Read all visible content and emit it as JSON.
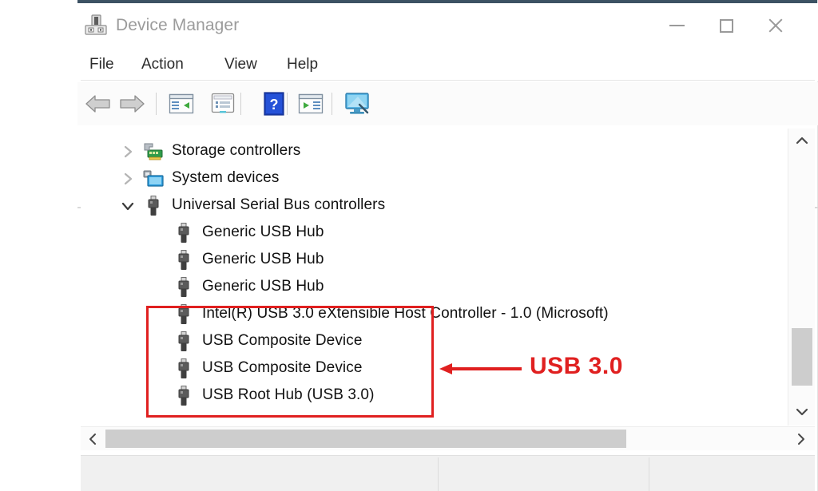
{
  "window": {
    "title": "Device Manager",
    "title_icon": "device-manager-icon",
    "controls": {
      "minimize": "minimize-icon",
      "maximize": "maximize-icon",
      "close": "close-icon"
    }
  },
  "menubar": {
    "items": [
      {
        "label": "File"
      },
      {
        "label": "Action"
      },
      {
        "label": "View"
      },
      {
        "label": "Help"
      }
    ]
  },
  "toolbar": {
    "buttons": [
      {
        "name": "back-arrow-icon"
      },
      {
        "name": "forward-arrow-icon"
      },
      {
        "name": "properties-icon"
      },
      {
        "name": "show-details-icon"
      },
      {
        "name": "help-icon"
      },
      {
        "name": "update-driver-icon"
      },
      {
        "name": "scan-for-hardware-changes-icon"
      }
    ]
  },
  "tree": {
    "rows": [
      {
        "label": "Storage controllers",
        "level": 0,
        "expander": "chevron-right-icon",
        "expanded": false,
        "icon": "storage-controller-icon"
      },
      {
        "label": "System devices",
        "level": 0,
        "expander": "chevron-right-icon",
        "expanded": false,
        "icon": "system-device-icon"
      },
      {
        "label": "Universal Serial Bus controllers",
        "level": 0,
        "expander": "chevron-down-icon",
        "expanded": true,
        "icon": "usb-icon"
      },
      {
        "label": "Generic USB Hub",
        "level": 1,
        "icon": "usb-icon"
      },
      {
        "label": "Generic USB Hub",
        "level": 1,
        "icon": "usb-icon"
      },
      {
        "label": "Generic USB Hub",
        "level": 1,
        "icon": "usb-icon"
      },
      {
        "label": "Intel(R) USB 3.0 eXtensible Host Controller - 1.0 (Microsoft)",
        "level": 1,
        "icon": "usb-icon"
      },
      {
        "label": "USB Composite Device",
        "level": 1,
        "icon": "usb-icon"
      },
      {
        "label": "USB Composite Device",
        "level": 1,
        "icon": "usb-icon"
      },
      {
        "label": "USB Root Hub (USB 3.0)",
        "level": 1,
        "icon": "usb-icon"
      }
    ]
  },
  "scrollbars": {
    "vertical": {
      "up": "⌃",
      "down": "⌄"
    },
    "horizontal": {
      "left": "‹",
      "right": "›"
    }
  },
  "annotation": {
    "label": "USB 3.0",
    "color": "#e02020",
    "arrow": "left-arrow-icon"
  },
  "statusbar": {
    "cells": [
      "",
      "",
      ""
    ]
  }
}
